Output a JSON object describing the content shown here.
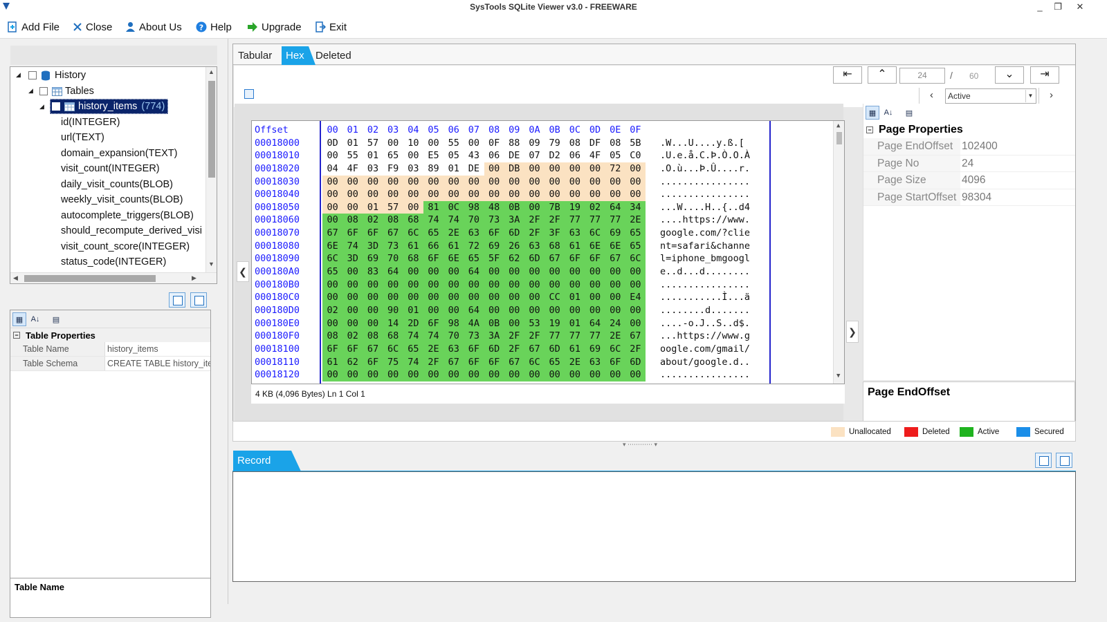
{
  "window": {
    "title": "SysTools SQLite Viewer  v3.0 - FREEWARE",
    "minimize": "_",
    "restore": "❐",
    "close": "✕"
  },
  "menu": {
    "add_file": "Add File",
    "close": "Close",
    "about_us": "About Us",
    "help": "Help",
    "upgrade": "Upgrade",
    "exit": "Exit"
  },
  "tree": {
    "root": "History",
    "tables": "Tables",
    "selected_table": "history_items",
    "selected_count": "(774)",
    "columns": [
      "id(INTEGER)",
      "url(TEXT)",
      "domain_expansion(TEXT)",
      "visit_count(INTEGER)",
      "daily_visit_counts(BLOB)",
      "weekly_visit_counts(BLOB)",
      "autocomplete_triggers(BLOB)",
      "should_recompute_derived_visi",
      "visit_count_score(INTEGER)",
      "status_code(INTEGER)"
    ]
  },
  "table_props": {
    "category": "Table Properties",
    "rows": [
      {
        "key": "Table Name",
        "value": "history_items"
      },
      {
        "key": "Table Schema",
        "value": "CREATE TABLE history_item"
      }
    ],
    "description_title": "Table Name"
  },
  "tabs": {
    "tabular": "Tabular",
    "hex": "Hex",
    "deleted": "Deleted"
  },
  "pager": {
    "current_page": "24",
    "slash": "/",
    "total_pages": "60",
    "first": "⇤",
    "prev": "⌃",
    "next": "⌄",
    "last": "⇥",
    "filter_prev": "‹",
    "filter_next": "›",
    "filter_value": "Active"
  },
  "hex": {
    "offset_header": "Offset",
    "byte_headers": [
      "00",
      "01",
      "02",
      "03",
      "04",
      "05",
      "06",
      "07",
      "08",
      "09",
      "0A",
      "0B",
      "0C",
      "0D",
      "0E",
      "0F"
    ],
    "offsets": [
      "00018000",
      "00018010",
      "00018020",
      "00018030",
      "00018040",
      "00018050",
      "00018060",
      "00018070",
      "00018080",
      "00018090",
      "000180A0",
      "000180B0",
      "000180C0",
      "000180D0",
      "000180E0",
      "000180F0",
      "00018100",
      "00018110",
      "00018120"
    ],
    "rows": [
      "0D 01 57 00 10 00 55 00 0F 88 09 79 08 DF 08 5B",
      "00 55 01 65 00 E5 05 43 06 DE 07 D2 06 4F 05 C0",
      "04 4F 03 F9 03 89 01 DE 00 DB 00 00 00 00 72 00",
      "00 00 00 00 00 00 00 00 00 00 00 00 00 00 00 00",
      "00 00 00 00 00 00 00 00 00 00 00 00 00 00 00 00",
      "00 00 01 57 00 81 0C 98 48 0B 00 7B 19 02 64 34",
      "00 08 02 08 68 74 74 70 73 3A 2F 2F 77 77 77 2E",
      "67 6F 6F 67 6C 65 2E 63 6F 6D 2F 3F 63 6C 69 65",
      "6E 74 3D 73 61 66 61 72 69 26 63 68 61 6E 6E 65",
      "6C 3D 69 70 68 6F 6E 65 5F 62 6D 67 6F 6F 67 6C",
      "65 00 83 64 00 00 00 64 00 00 00 00 00 00 00 00",
      "00 00 00 00 00 00 00 00 00 00 00 00 00 00 00 00",
      "00 00 00 00 00 00 00 00 00 00 00 CC 01 00 00 E4",
      "02 00 00 90 01 00 00 64 00 00 00 00 00 00 00 00",
      "00 00 00 14 2D 6F 98 4A 0B 00 53 19 01 64 24 00",
      "08 02 08 68 74 74 70 73 3A 2F 2F 77 77 77 2E 67",
      "6F 6F 67 6C 65 2E 63 6F 6D 2F 67 6D 61 69 6C 2F",
      "61 62 6F 75 74 2F 67 6F 6F 67 6C 65 2E 63 6F 6D",
      "00 00 00 00 00 00 00 00 00 00 00 00 00 00 00 00"
    ],
    "ascii": [
      ".W...U....y.ß.[",
      ".U.e.å.C.Þ.Ò.O.À",
      ".O.ù...Þ.Û....r.",
      "................",
      "................",
      "...W....H..{..d4",
      "....https://www.",
      "google.com/?clie",
      "nt=safari&channe",
      "l=iphone_bmgoogl",
      "e..d...d........",
      "................",
      "...........Ì...ä",
      "........d.......",
      "....-o.J..S..d$.",
      "...https://www.g",
      "oogle.com/gmail/",
      "about/google.d..",
      "................"
    ],
    "status": "4 KB (4,096 Bytes)   Ln 1     Col 1"
  },
  "page_props": {
    "category": "Page Properties",
    "rows": [
      {
        "key": "Page EndOffset",
        "value": "102400"
      },
      {
        "key": "Page No",
        "value": "24"
      },
      {
        "key": "Page Size",
        "value": "4096"
      },
      {
        "key": "Page StartOffset",
        "value": "98304"
      }
    ],
    "description_title": "Page EndOffset"
  },
  "legend": {
    "items": [
      {
        "label": "Unallocated",
        "color": "#fbe2c2"
      },
      {
        "label": "Deleted",
        "color": "#ee1c1c"
      },
      {
        "label": "Active",
        "color": "#1fb31f"
      },
      {
        "label": "Secured",
        "color": "#1b8ee8"
      }
    ]
  },
  "record": {
    "tab": "Record"
  },
  "colors": {
    "accent": "#1aa3e8",
    "unallocated": "#fbe2c2",
    "active": "#69d35a",
    "offset_text": "#1a1aff"
  }
}
